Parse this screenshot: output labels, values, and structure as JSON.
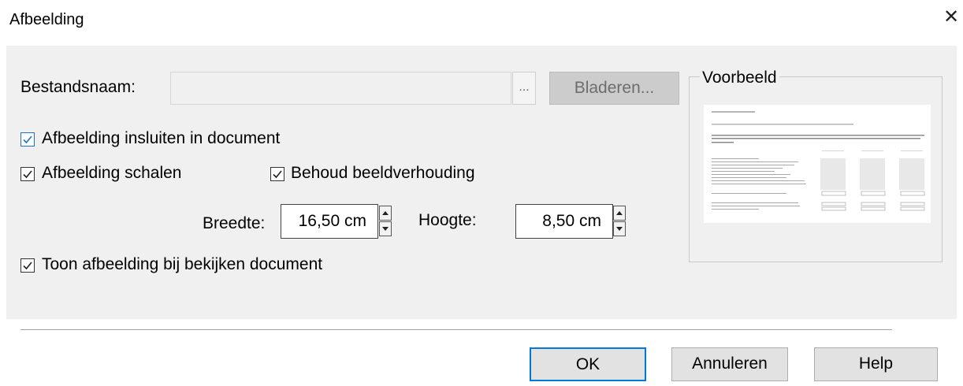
{
  "dialog": {
    "title": "Afbeelding",
    "close_glyph": "✕"
  },
  "filename": {
    "label": "Bestandsnaam:",
    "value": "",
    "ellipsis_label": "...",
    "browse_label": "Bladeren..."
  },
  "options": {
    "embed": {
      "label": "Afbeelding insluiten in document",
      "checked": true
    },
    "scale": {
      "label": "Afbeelding schalen",
      "checked": true
    },
    "keep_ratio": {
      "label": "Behoud beeldverhouding",
      "checked": true
    },
    "show_on_view": {
      "label": "Toon afbeelding bij bekijken document",
      "checked": true
    }
  },
  "size": {
    "width_label": "Breedte:",
    "width_value": "16,50 cm",
    "height_label": "Hoogte:",
    "height_value": "8,50 cm"
  },
  "preview": {
    "title": "Voorbeeld"
  },
  "buttons": {
    "ok": "OK",
    "cancel": "Annuleren",
    "help": "Help"
  },
  "colors": {
    "accent": "#0078d7",
    "panel_bg": "#f0f0f0",
    "button_bg": "#e2e2e2"
  }
}
